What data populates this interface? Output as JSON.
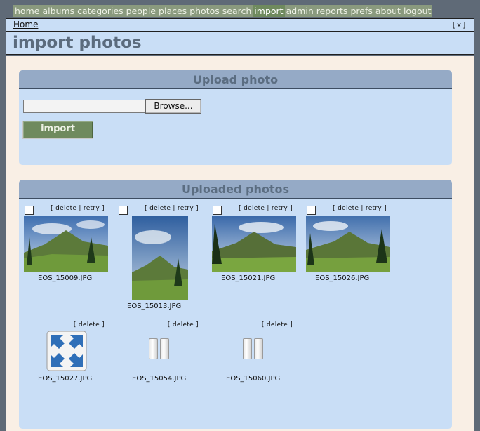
{
  "nav": {
    "items": [
      {
        "id": "home",
        "label": "home"
      },
      {
        "id": "albums",
        "label": "albums"
      },
      {
        "id": "categories",
        "label": "categories"
      },
      {
        "id": "people",
        "label": "people"
      },
      {
        "id": "places",
        "label": "places"
      },
      {
        "id": "photos",
        "label": "photos"
      },
      {
        "id": "search",
        "label": "search"
      },
      {
        "id": "import",
        "label": "import",
        "active": true
      },
      {
        "id": "admin",
        "label": "admin"
      },
      {
        "id": "reports",
        "label": "reports"
      },
      {
        "id": "prefs",
        "label": "prefs"
      },
      {
        "id": "about",
        "label": "about"
      },
      {
        "id": "logout",
        "label": "logout"
      }
    ]
  },
  "breadcrumb": {
    "home": "Home",
    "close": "[x]"
  },
  "page": {
    "title": "import photos"
  },
  "upload": {
    "heading": "Upload photo",
    "file_value": "",
    "browse_label": "Browse...",
    "import_label": "import"
  },
  "uploaded": {
    "heading": "Uploaded photos",
    "photos": [
      {
        "file": "EOS_15009.JPG",
        "actions": "[ delete | retry ]",
        "checkbox": true,
        "state": "landscape"
      },
      {
        "file": "EOS_15013.JPG",
        "actions": "[ delete | retry ]",
        "checkbox": true,
        "state": "portrait"
      },
      {
        "file": "EOS_15021.JPG",
        "actions": "[ delete | retry ]",
        "checkbox": true,
        "state": "landscape"
      },
      {
        "file": "EOS_15026.JPG",
        "actions": "[ delete | retry ]",
        "checkbox": true,
        "state": "landscape"
      },
      {
        "file": "EOS_15027.JPG",
        "actions": "[ delete ]",
        "checkbox": false,
        "state": "resize-icon"
      },
      {
        "file": "EOS_15054.JPG",
        "actions": "[ delete ]",
        "checkbox": false,
        "state": "pause-icon"
      },
      {
        "file": "EOS_15060.JPG",
        "actions": "[ delete ]",
        "checkbox": false,
        "state": "pause-icon"
      }
    ]
  },
  "colors": {
    "nav_bg": "#8a9a7e",
    "nav_active": "#6f8a5e",
    "panel_bg": "#c9def6",
    "panel_header": "#95aac6",
    "content_bg": "#f9efe5"
  }
}
